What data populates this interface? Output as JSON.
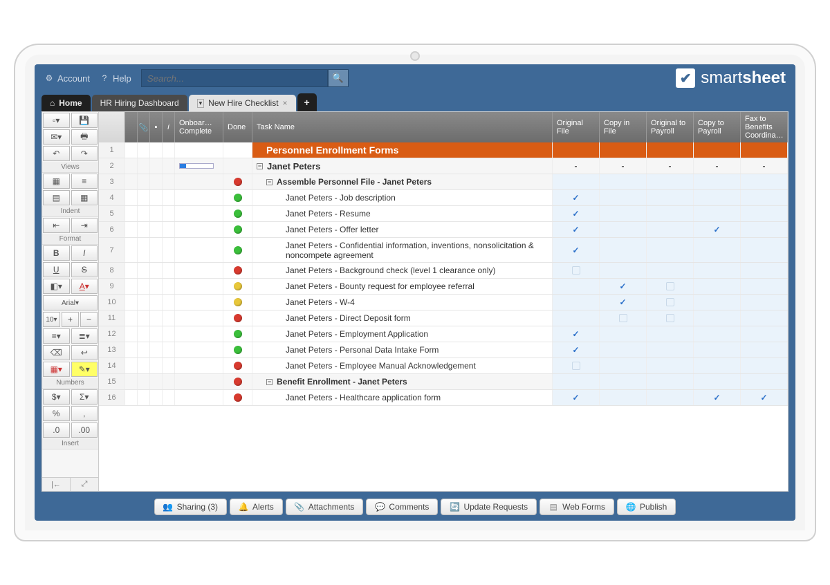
{
  "topbar": {
    "account": "Account",
    "help": "Help",
    "search_placeholder": "Search..."
  },
  "brand": {
    "name_light": "smart",
    "name_bold": "sheet"
  },
  "tabs": {
    "home": "Home",
    "dashboard": "HR Hiring Dashboard",
    "active": "New Hire Checklist"
  },
  "sidebar": {
    "views": "Views",
    "indent": "Indent",
    "format": "Format",
    "font": "Arial",
    "size": "10",
    "numbers": "Numbers",
    "insert": "Insert"
  },
  "columns": {
    "complete": "Onboar… Complete",
    "done": "Done",
    "task": "Task Name",
    "c1": "Original File",
    "c2": "Copy in File",
    "c3": "Original to Payroll",
    "c4": "Copy to Payroll",
    "c5": "Fax to Benefits Coordina…"
  },
  "rows": [
    {
      "n": 1,
      "type": "section",
      "task": "Personnel Enrollment Forms"
    },
    {
      "n": 2,
      "type": "person",
      "task": "Janet Peters",
      "progress": 0.18,
      "checks": [
        "-",
        "-",
        "-",
        "-",
        "-"
      ]
    },
    {
      "n": 3,
      "type": "group",
      "dot": "red",
      "task": "Assemble Personnel File - Janet Peters"
    },
    {
      "n": 4,
      "dot": "green",
      "task": "Janet Peters - Job description",
      "checks": [
        "t",
        "",
        "",
        "",
        ""
      ]
    },
    {
      "n": 5,
      "dot": "green",
      "task": "Janet Peters - Resume",
      "checks": [
        "t",
        "",
        "",
        "",
        ""
      ]
    },
    {
      "n": 6,
      "dot": "green",
      "task": "Janet Peters - Offer letter",
      "checks": [
        "t",
        "",
        "",
        "t",
        ""
      ]
    },
    {
      "n": 7,
      "tall": true,
      "dot": "green",
      "task": "Janet Peters - Confidential information, inventions, nonsolicitation & noncompete agreement",
      "checks": [
        "t",
        "",
        "",
        "",
        ""
      ]
    },
    {
      "n": 8,
      "dot": "red",
      "task": "Janet Peters - Background check (level 1 clearance only)",
      "checks": [
        "b",
        "",
        "",
        "",
        ""
      ]
    },
    {
      "n": 9,
      "dot": "yellow",
      "task": "Janet Peters - Bounty request for employee referral",
      "checks": [
        "",
        "t",
        "b",
        "",
        ""
      ]
    },
    {
      "n": 10,
      "dot": "yellow",
      "task": "Janet Peters - W-4",
      "checks": [
        "",
        "t",
        "b",
        "",
        ""
      ]
    },
    {
      "n": 11,
      "dot": "red",
      "task": "Janet Peters - Direct Deposit form",
      "checks": [
        "",
        "b",
        "b",
        "",
        ""
      ]
    },
    {
      "n": 12,
      "dot": "green",
      "task": "Janet Peters - Employment Application",
      "checks": [
        "t",
        "",
        "",
        "",
        ""
      ]
    },
    {
      "n": 13,
      "dot": "green",
      "task": "Janet Peters - Personal Data Intake Form",
      "checks": [
        "t",
        "",
        "",
        "",
        ""
      ]
    },
    {
      "n": 14,
      "dot": "red",
      "task": "Janet Peters - Employee Manual Acknowledgement",
      "checks": [
        "b",
        "",
        "",
        "",
        ""
      ]
    },
    {
      "n": 15,
      "type": "group",
      "dot": "red",
      "task": "Benefit Enrollment - Janet Peters"
    },
    {
      "n": 16,
      "dot": "red",
      "task": "Janet Peters - Healthcare application form",
      "checks": [
        "t",
        "",
        "",
        "t",
        "t"
      ]
    }
  ],
  "bottom": {
    "sharing": "Sharing  (3)",
    "alerts": "Alerts",
    "attachments": "Attachments",
    "comments": "Comments",
    "updates": "Update Requests",
    "forms": "Web Forms",
    "publish": "Publish"
  }
}
